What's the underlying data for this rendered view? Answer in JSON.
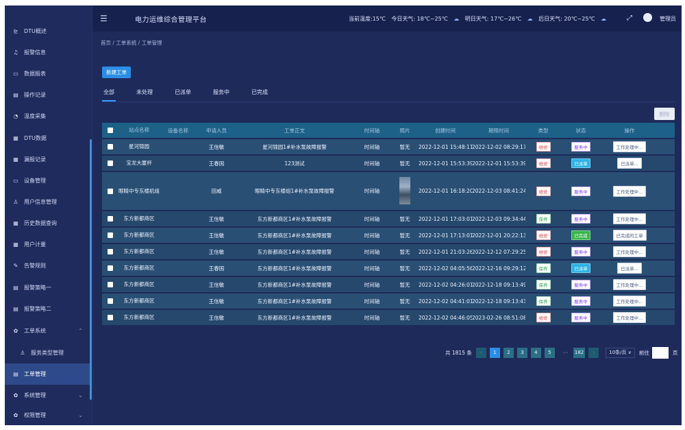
{
  "header": {
    "title": "电力运维综合管理平台",
    "weather": {
      "current_temp": "当前温度:15℃",
      "today": "今日天气: 18℃~25℃",
      "tomorrow": "明日天气: 17℃~26℃",
      "day_after": "后日天气: 20℃~25℃"
    },
    "user": "管理员"
  },
  "sidebar": {
    "items": [
      {
        "label": "DTU概述",
        "icon": "chart-icon"
      },
      {
        "label": "报警信息",
        "icon": "bell-icon"
      },
      {
        "label": "数据报表",
        "icon": "monitor-icon"
      },
      {
        "label": "操作记录",
        "icon": "document-icon"
      },
      {
        "label": "温度采集",
        "icon": "gauge-icon"
      },
      {
        "label": "DTU数据",
        "icon": "grid-icon"
      },
      {
        "label": "漏报记录",
        "icon": "grid-icon"
      },
      {
        "label": "设备管理",
        "icon": "monitor-icon"
      },
      {
        "label": "用户信息管理",
        "icon": "user-icon"
      },
      {
        "label": "历史数据查询",
        "icon": "grid-icon"
      },
      {
        "label": "用户计量",
        "icon": "grid-icon"
      },
      {
        "label": "告警规则",
        "icon": "edit-icon"
      },
      {
        "label": "报警策略一",
        "icon": "document-icon"
      },
      {
        "label": "报警策略二",
        "icon": "document-icon"
      },
      {
        "label": "工单系统",
        "icon": "gear-icon"
      },
      {
        "label": "服务类型管理",
        "icon": "user-icon"
      },
      {
        "label": "工单管理",
        "icon": "document-icon"
      },
      {
        "label": "系统管理",
        "icon": "gear-icon"
      },
      {
        "label": "权限管理",
        "icon": "gear-icon"
      }
    ]
  },
  "breadcrumb": "首页 / 工单系统 / 工单管理",
  "toolbar": {
    "new_label": "新建工单",
    "delete_label": "删除"
  },
  "tabs": [
    "全部",
    "未处理",
    "已派单",
    "服务中",
    "已完成"
  ],
  "table": {
    "columns": [
      "",
      "站点名称",
      "设备名称",
      "申请人员",
      "工单正文",
      "时间轴",
      "照片",
      "创建时间",
      "期限时间",
      "类型",
      "状态",
      "操作"
    ],
    "rows": [
      {
        "project": "星河锦园",
        "device": "",
        "person": "王信敏",
        "content": "星河锦园1#补水泵故障报警",
        "time": "时间轴",
        "photo": "暂无",
        "created": "2022-12-01 15:48:11",
        "deadline": "2022-12-02 08:29:17",
        "type": "维修",
        "type_color": "red",
        "status": "服务中",
        "status_color": "purple",
        "op": "工作处理中..."
      },
      {
        "project": "宝龙大厦杯",
        "device": "",
        "person": "王春国",
        "content": "123测试",
        "time": "时间轴",
        "photo": "暂无",
        "created": "2022-12-01 15:53:39",
        "deadline": "2022-12-01 15:53:39",
        "type": "维修",
        "type_color": "red",
        "status": "已派单",
        "status_color": "blue",
        "op": "已派单..."
      },
      {
        "project": "眼睛中专东楼机组",
        "device": "",
        "person": "田威",
        "content": "眼睛中专东楼组1#补水泵故障报警",
        "time": "时间轴",
        "photo": "",
        "created": "2022-12-01 16:18:20",
        "deadline": "2022-12-03 08:41:24",
        "type": "维修",
        "type_color": "red",
        "status": "服务中",
        "status_color": "purple",
        "op": "工作处理中..."
      },
      {
        "project": "东方新都商区",
        "device": "",
        "person": "王信敏",
        "content": "东方新都商区1#补水泵故障报警",
        "time": "时间轴",
        "photo": "暂无",
        "created": "2022-12-01 17:03:01",
        "deadline": "2022-12-03 09:34:44",
        "type": "保养",
        "type_color": "green",
        "status": "服务中",
        "status_color": "purple",
        "op": "工作处理中..."
      },
      {
        "project": "东方新都商区",
        "device": "",
        "person": "王信敏",
        "content": "东方新都商区1#补水泵故障报警",
        "time": "时间轴",
        "photo": "暂无",
        "created": "2022-12-01 17:13:01",
        "deadline": "2022-12-01 20:22:13",
        "type": "维修",
        "type_color": "red",
        "status": "已完成",
        "status_color": "green",
        "op": "已完成的工单"
      },
      {
        "project": "东方新都商区",
        "device": "",
        "person": "王信敏",
        "content": "东方新都商区1#补水泵故障报警",
        "time": "时间轴",
        "photo": "暂无",
        "created": "2022-12-01 21:03:26",
        "deadline": "2022-12-12 07:29:25",
        "type": "维修",
        "type_color": "red",
        "status": "服务中",
        "status_color": "purple",
        "op": "工作处理中..."
      },
      {
        "project": "东方新都商区",
        "device": "",
        "person": "王春国",
        "content": "东方新都商区1#补水泵故障报警",
        "time": "时间轴",
        "photo": "暂无",
        "created": "2022-12-02 04:05:56",
        "deadline": "2022-12-16 09:29:12",
        "type": "保养",
        "type_color": "green",
        "status": "已派单",
        "status_color": "blue",
        "op": "已派单..."
      },
      {
        "project": "东方新都商区",
        "device": "",
        "person": "王信敏",
        "content": "东方新都商区1#补水泵故障报警",
        "time": "时间轴",
        "photo": "暂无",
        "created": "2022-12-02 04:26:01",
        "deadline": "2022-12-18 09:13:49",
        "type": "保养",
        "type_color": "green",
        "status": "服务中",
        "status_color": "purple",
        "op": "工作处理中..."
      },
      {
        "project": "东方新都商区",
        "device": "",
        "person": "王信敏",
        "content": "东方新都商区1#补水泵故障报警",
        "time": "时间轴",
        "photo": "暂无",
        "created": "2022-12-02 04:41:01",
        "deadline": "2022-12-18 09:13:43",
        "type": "保养",
        "type_color": "green",
        "status": "服务中",
        "status_color": "purple",
        "op": "工作处理中..."
      },
      {
        "project": "东方新都商区",
        "device": "",
        "person": "王信敏",
        "content": "东方新都商区1#补水泵故障报警",
        "time": "时间轴",
        "photo": "暂无",
        "created": "2022-12-02 04:46:05",
        "deadline": "2023-02-26 08:51:08",
        "type": "维修",
        "type_color": "red",
        "status": "服务中",
        "status_color": "purple",
        "op": "工作处理中..."
      }
    ]
  },
  "pagination": {
    "total": "共 1815 条",
    "pages": [
      "1",
      "2",
      "3",
      "4",
      "5"
    ],
    "dots": "···",
    "last": "182",
    "page_size": "10条/页",
    "goto_label": "前往",
    "page_suffix": "页"
  }
}
